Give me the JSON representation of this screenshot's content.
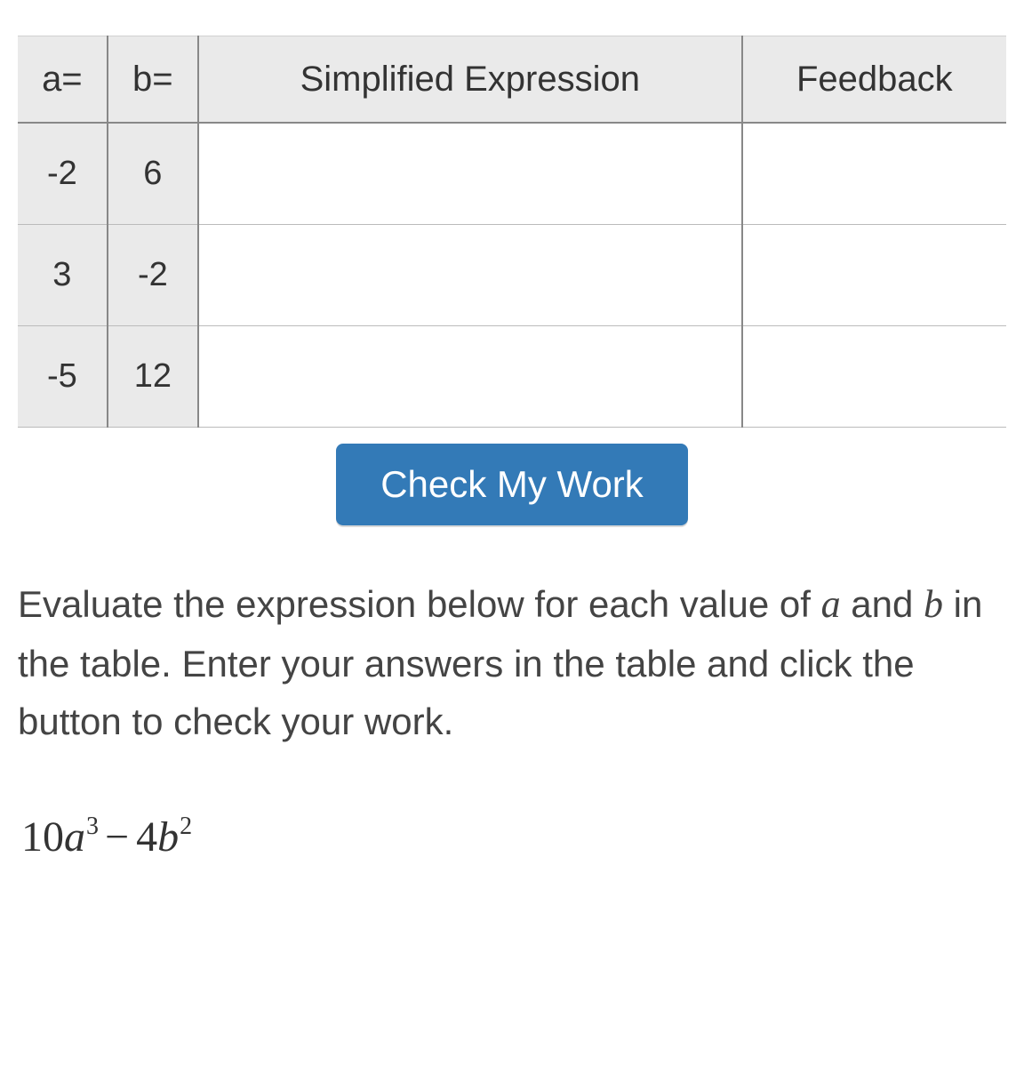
{
  "table": {
    "headers": {
      "a": "a=",
      "b": "b=",
      "simplified": "Simplified Expression",
      "feedback": "Feedback"
    },
    "rows": [
      {
        "a": "-2",
        "b": "6",
        "simplified": "",
        "feedback": ""
      },
      {
        "a": "3",
        "b": "-2",
        "simplified": "",
        "feedback": ""
      },
      {
        "a": "-5",
        "b": "12",
        "simplified": "",
        "feedback": ""
      }
    ]
  },
  "button": {
    "check_label": "Check My Work"
  },
  "instructions": {
    "part1": "Evaluate the expression below for each value of ",
    "var_a": "a",
    "part2": " and ",
    "var_b": "b",
    "part3": " in the table.  Enter your answers in the table and click the button to check your work."
  },
  "expression": {
    "coef1": "10",
    "var1": "a",
    "exp1": "3",
    "minus": "−",
    "coef2": "4",
    "var2": "b",
    "exp2": "2"
  }
}
